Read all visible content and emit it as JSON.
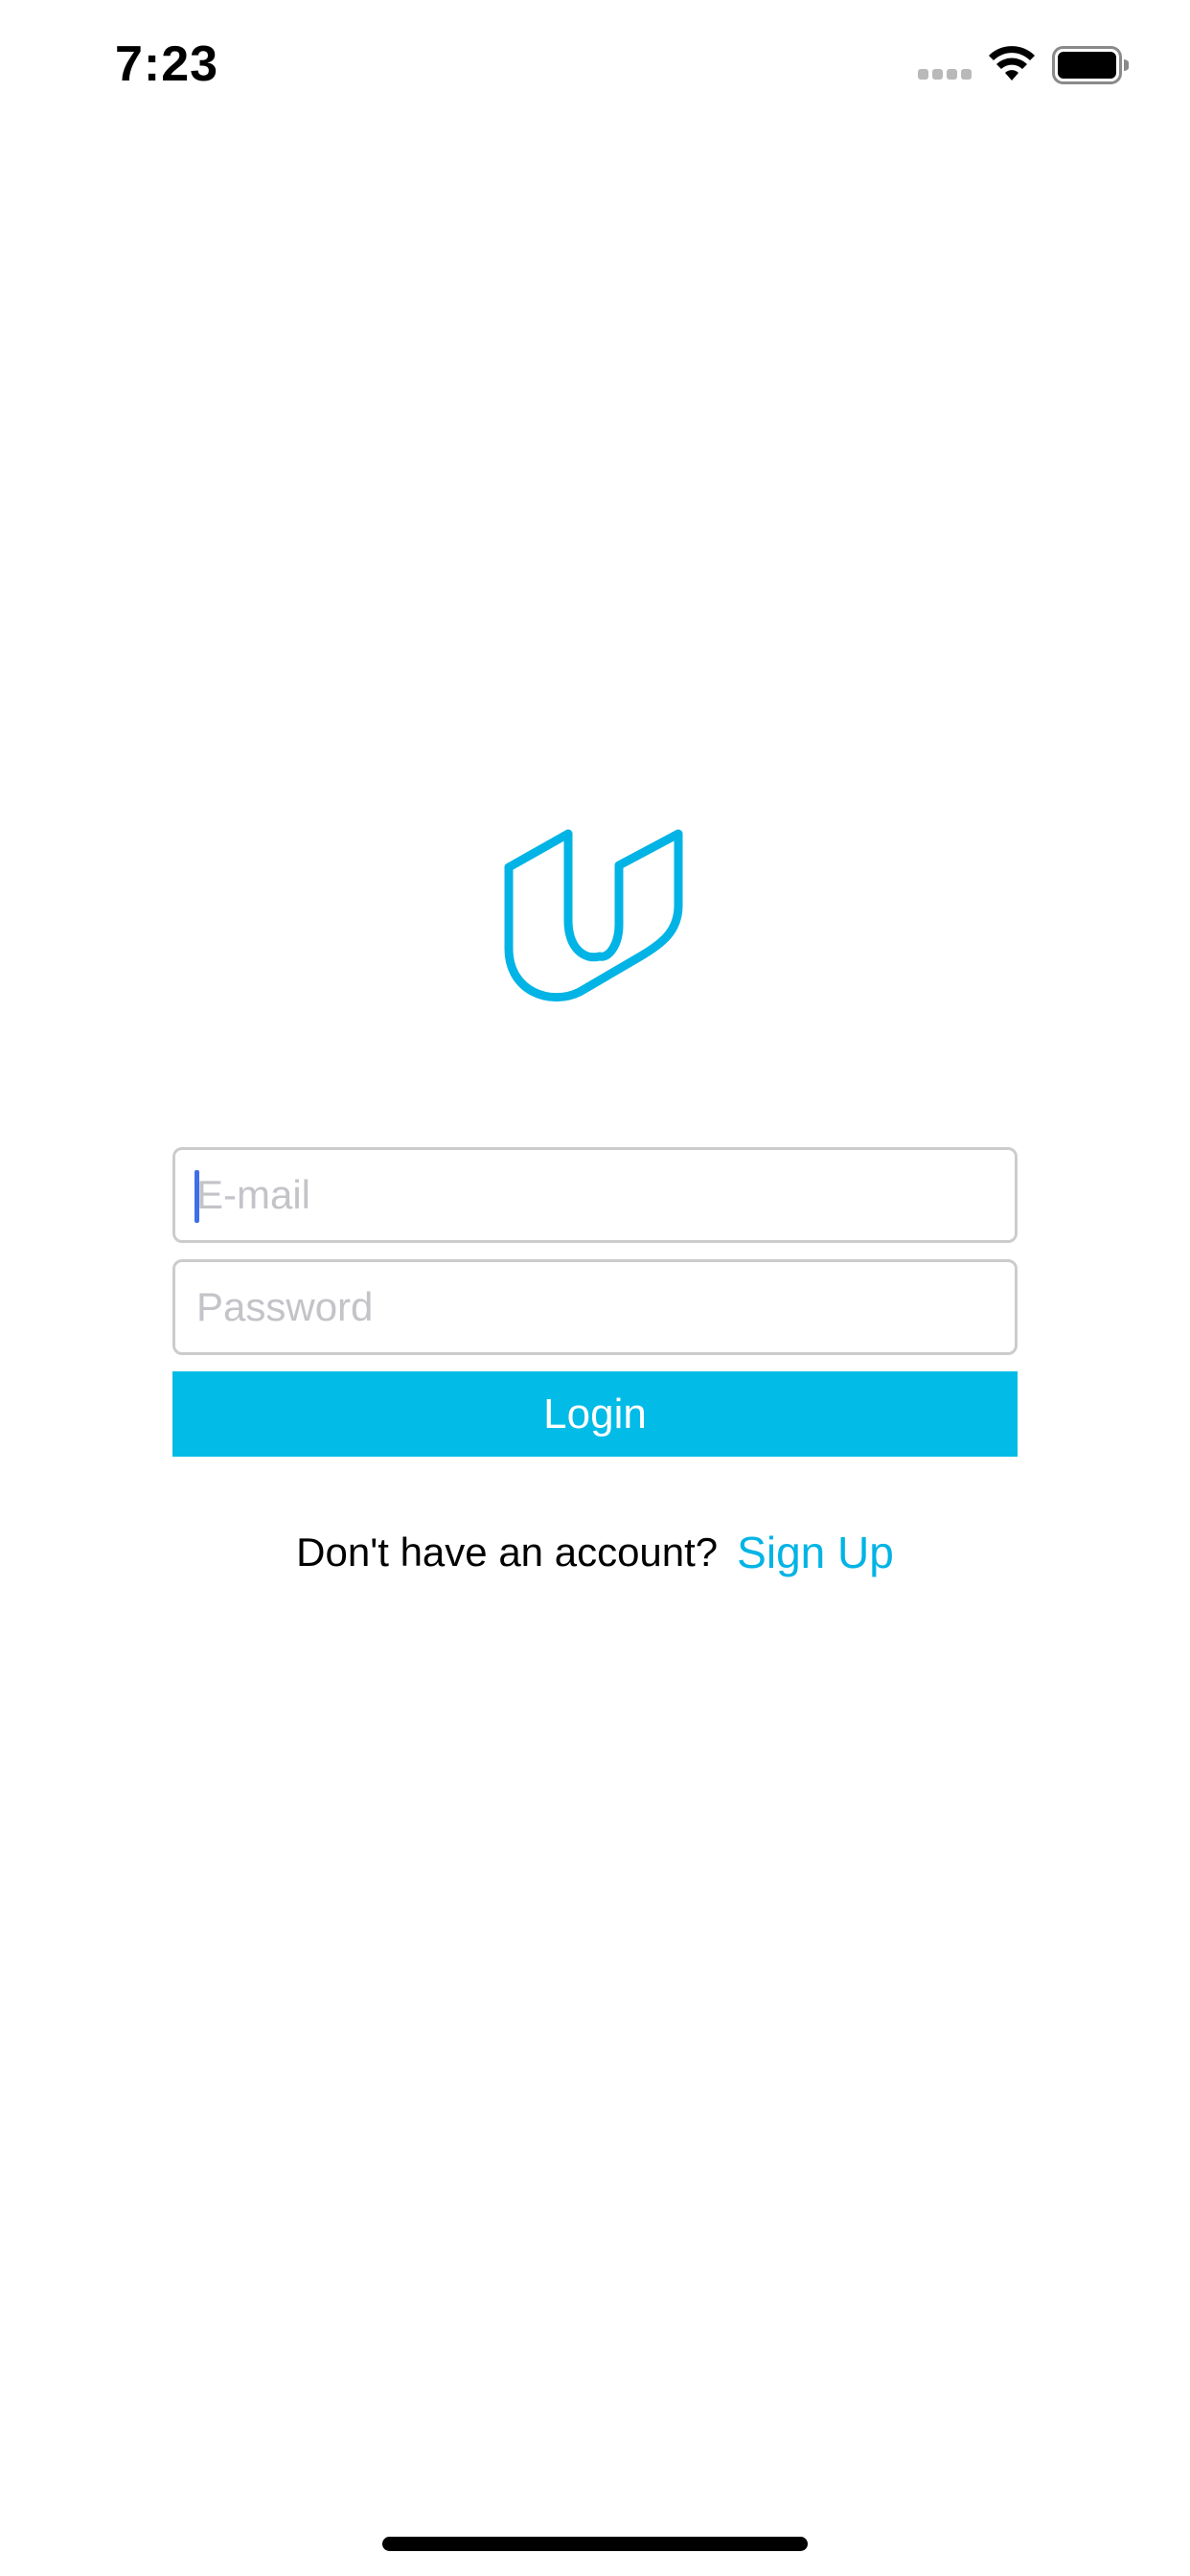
{
  "status_bar": {
    "time": "7:23",
    "icons": [
      "signal-icon",
      "wifi-icon",
      "battery-icon"
    ]
  },
  "logo": {
    "icon": "udacity-logo-icon",
    "color": "#02b4e5"
  },
  "form": {
    "email": {
      "value": "",
      "placeholder": "E-mail",
      "focused": true
    },
    "password": {
      "value": "",
      "placeholder": "Password"
    },
    "login_label": "Login"
  },
  "signup": {
    "prompt": "Don't have an account?",
    "link_label": "Sign Up"
  },
  "colors": {
    "accent": "#02bbe7",
    "link": "#02b4e5",
    "caret": "#3e6fe6",
    "placeholder": "#c3c3c8",
    "border": "#cccccc"
  }
}
